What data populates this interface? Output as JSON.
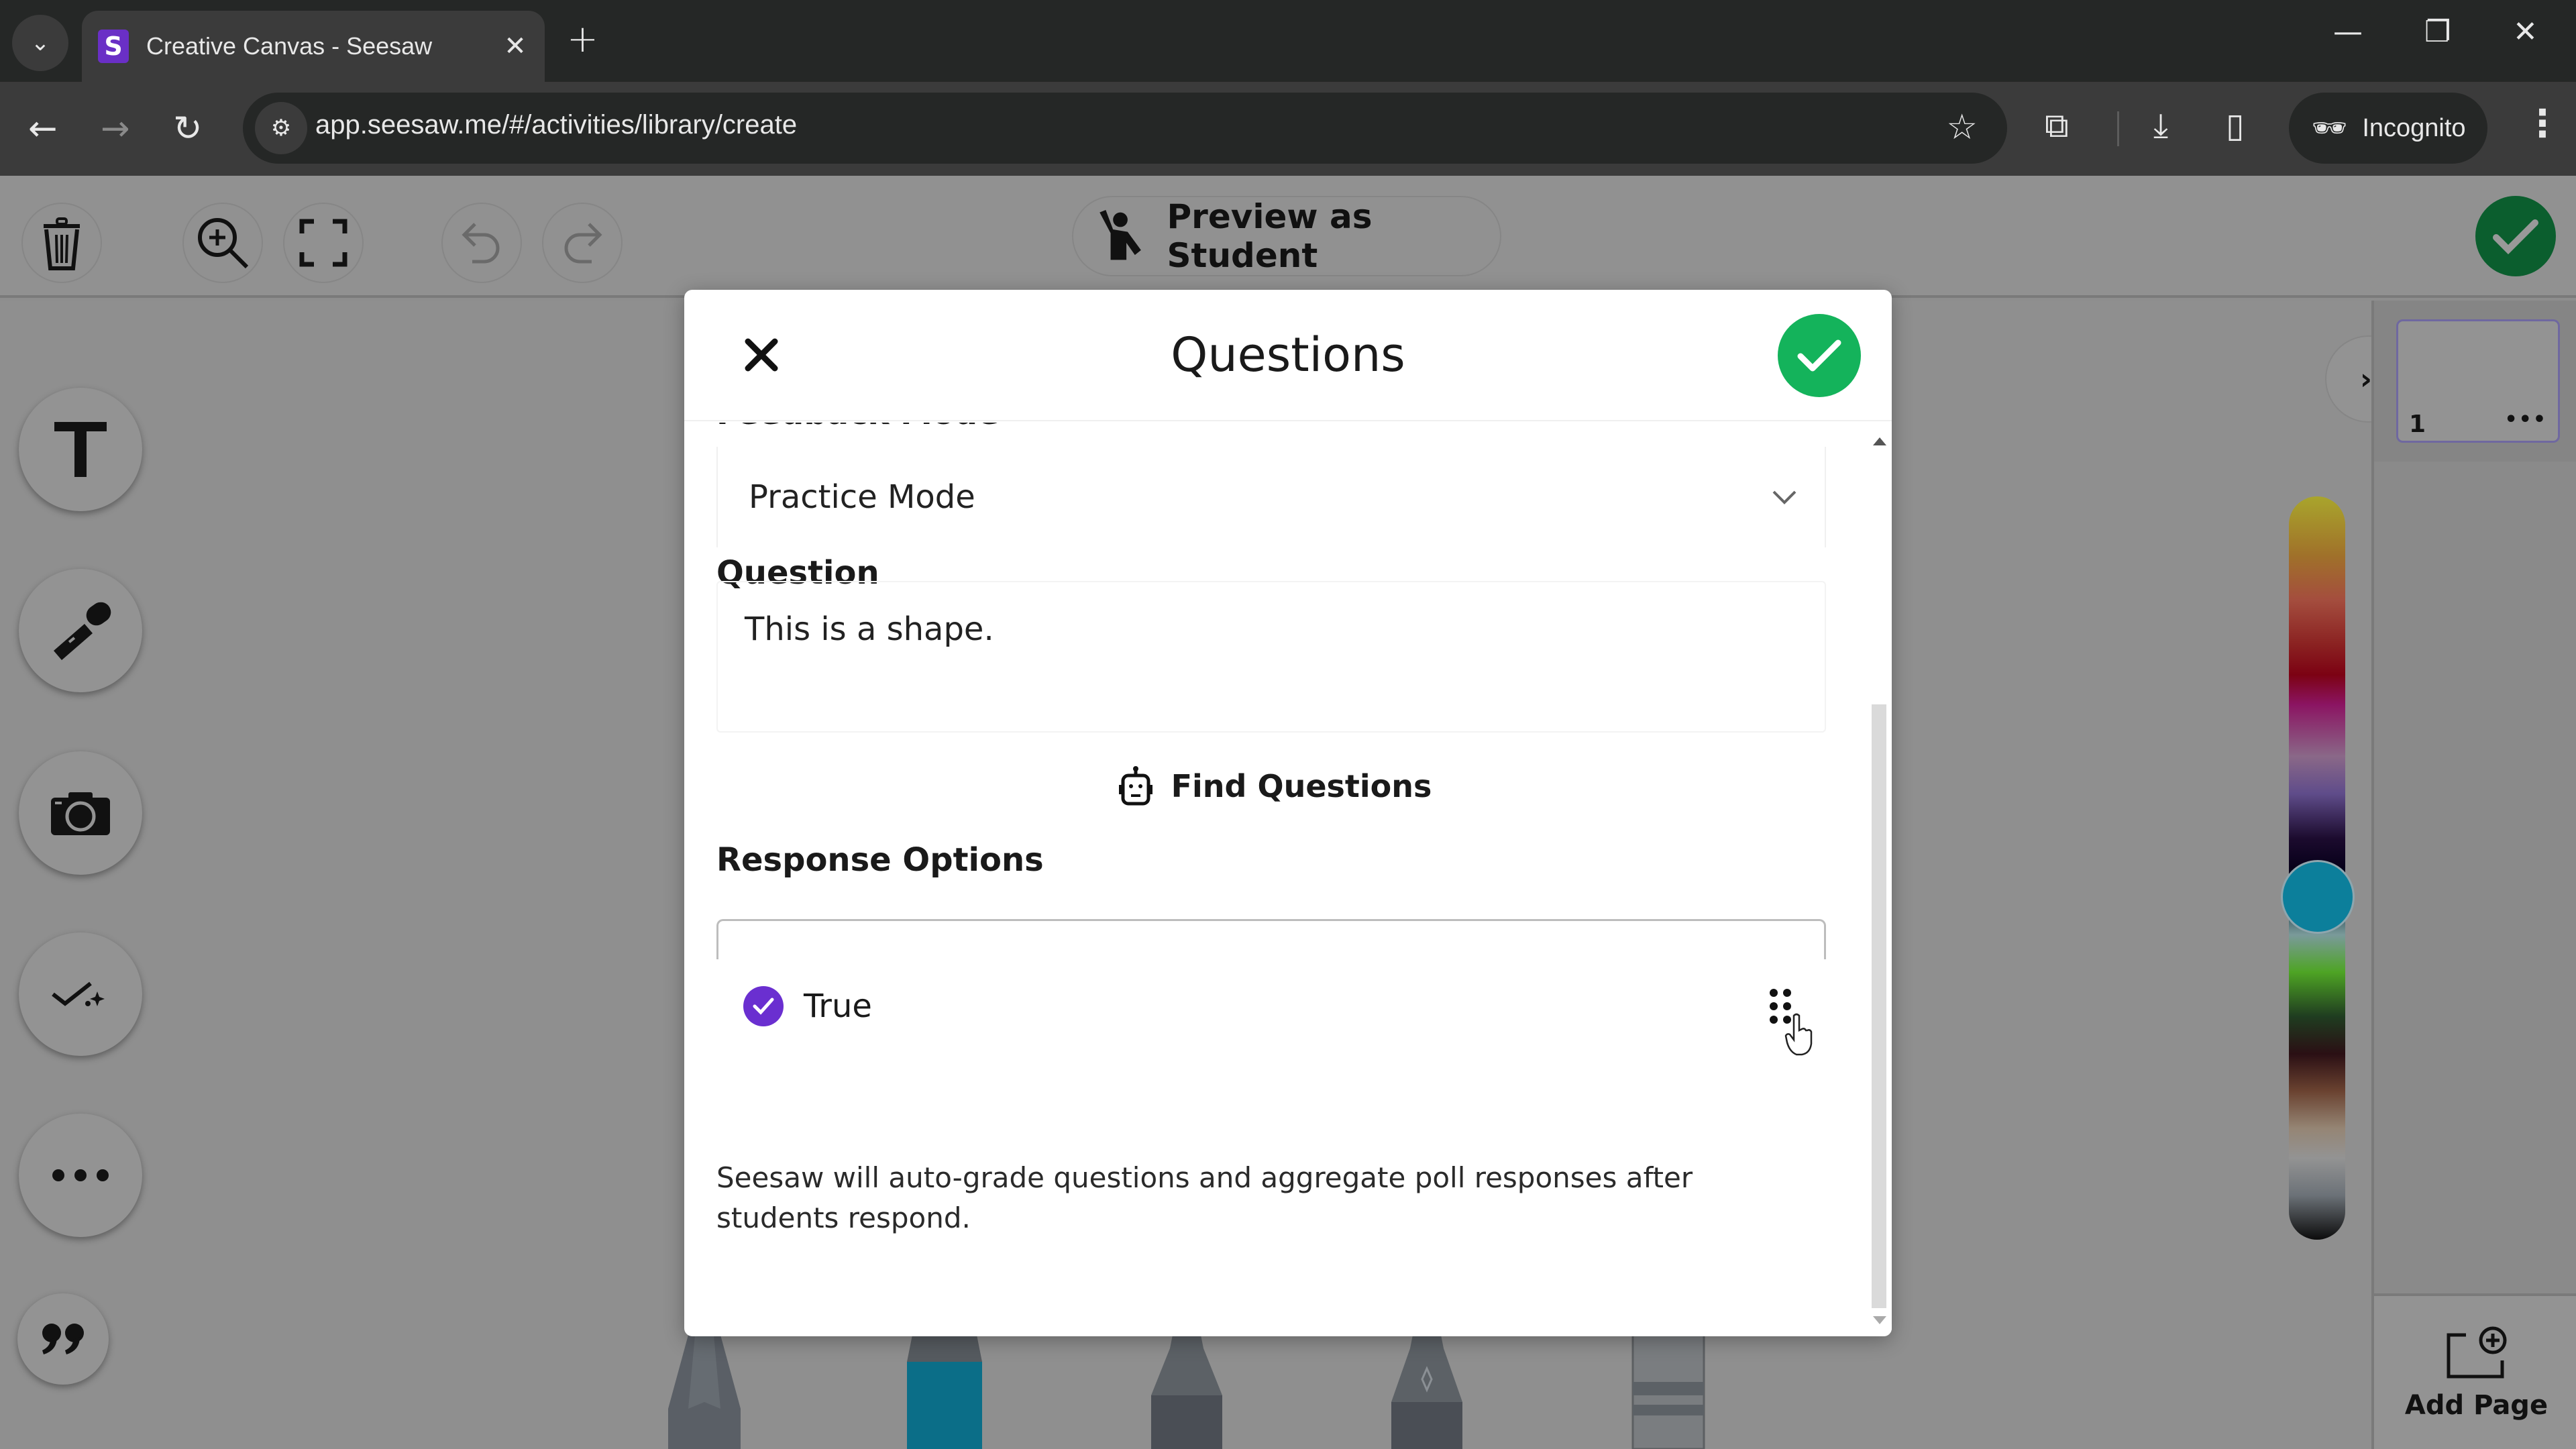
{
  "browser": {
    "tab_title": "Creative Canvas - Seesaw",
    "favicon_letter": "S",
    "url": "app.seesaw.me/#/activities/library/create",
    "incognito_label": "Incognito"
  },
  "toolbar": {
    "preview_label": "Preview as Student",
    "icons": [
      "trash-icon",
      "zoom-in-icon",
      "fullscreen-icon",
      "undo-icon",
      "redo-icon",
      "check-icon"
    ]
  },
  "left_tools": [
    "text-tool",
    "microphone-tool",
    "camera-tool",
    "questions-tool",
    "more-tool",
    "quote-tool"
  ],
  "pages": {
    "items": [
      {
        "number": "1",
        "more": "•••"
      }
    ],
    "add_page_label": "Add Page"
  },
  "color_picker": {
    "selected_color": "#0c7f9b"
  },
  "modal": {
    "title": "Questions",
    "feedback_mode_label": "Feedback Mode",
    "feedback_mode_value": "Practice Mode",
    "question_label": "Question",
    "question_text": "This is a shape.",
    "find_questions_label": "Find Questions",
    "response_options_label": "Response Options",
    "responses": [
      {
        "text": "True",
        "correct": true
      }
    ],
    "footnote": "Seesaw will auto-grade questions and aggregate poll responses after students respond."
  },
  "colors": {
    "accent_green": "#14b35b",
    "accent_purple": "#6a2fd0",
    "brand_purple": "#6a2fc6"
  }
}
